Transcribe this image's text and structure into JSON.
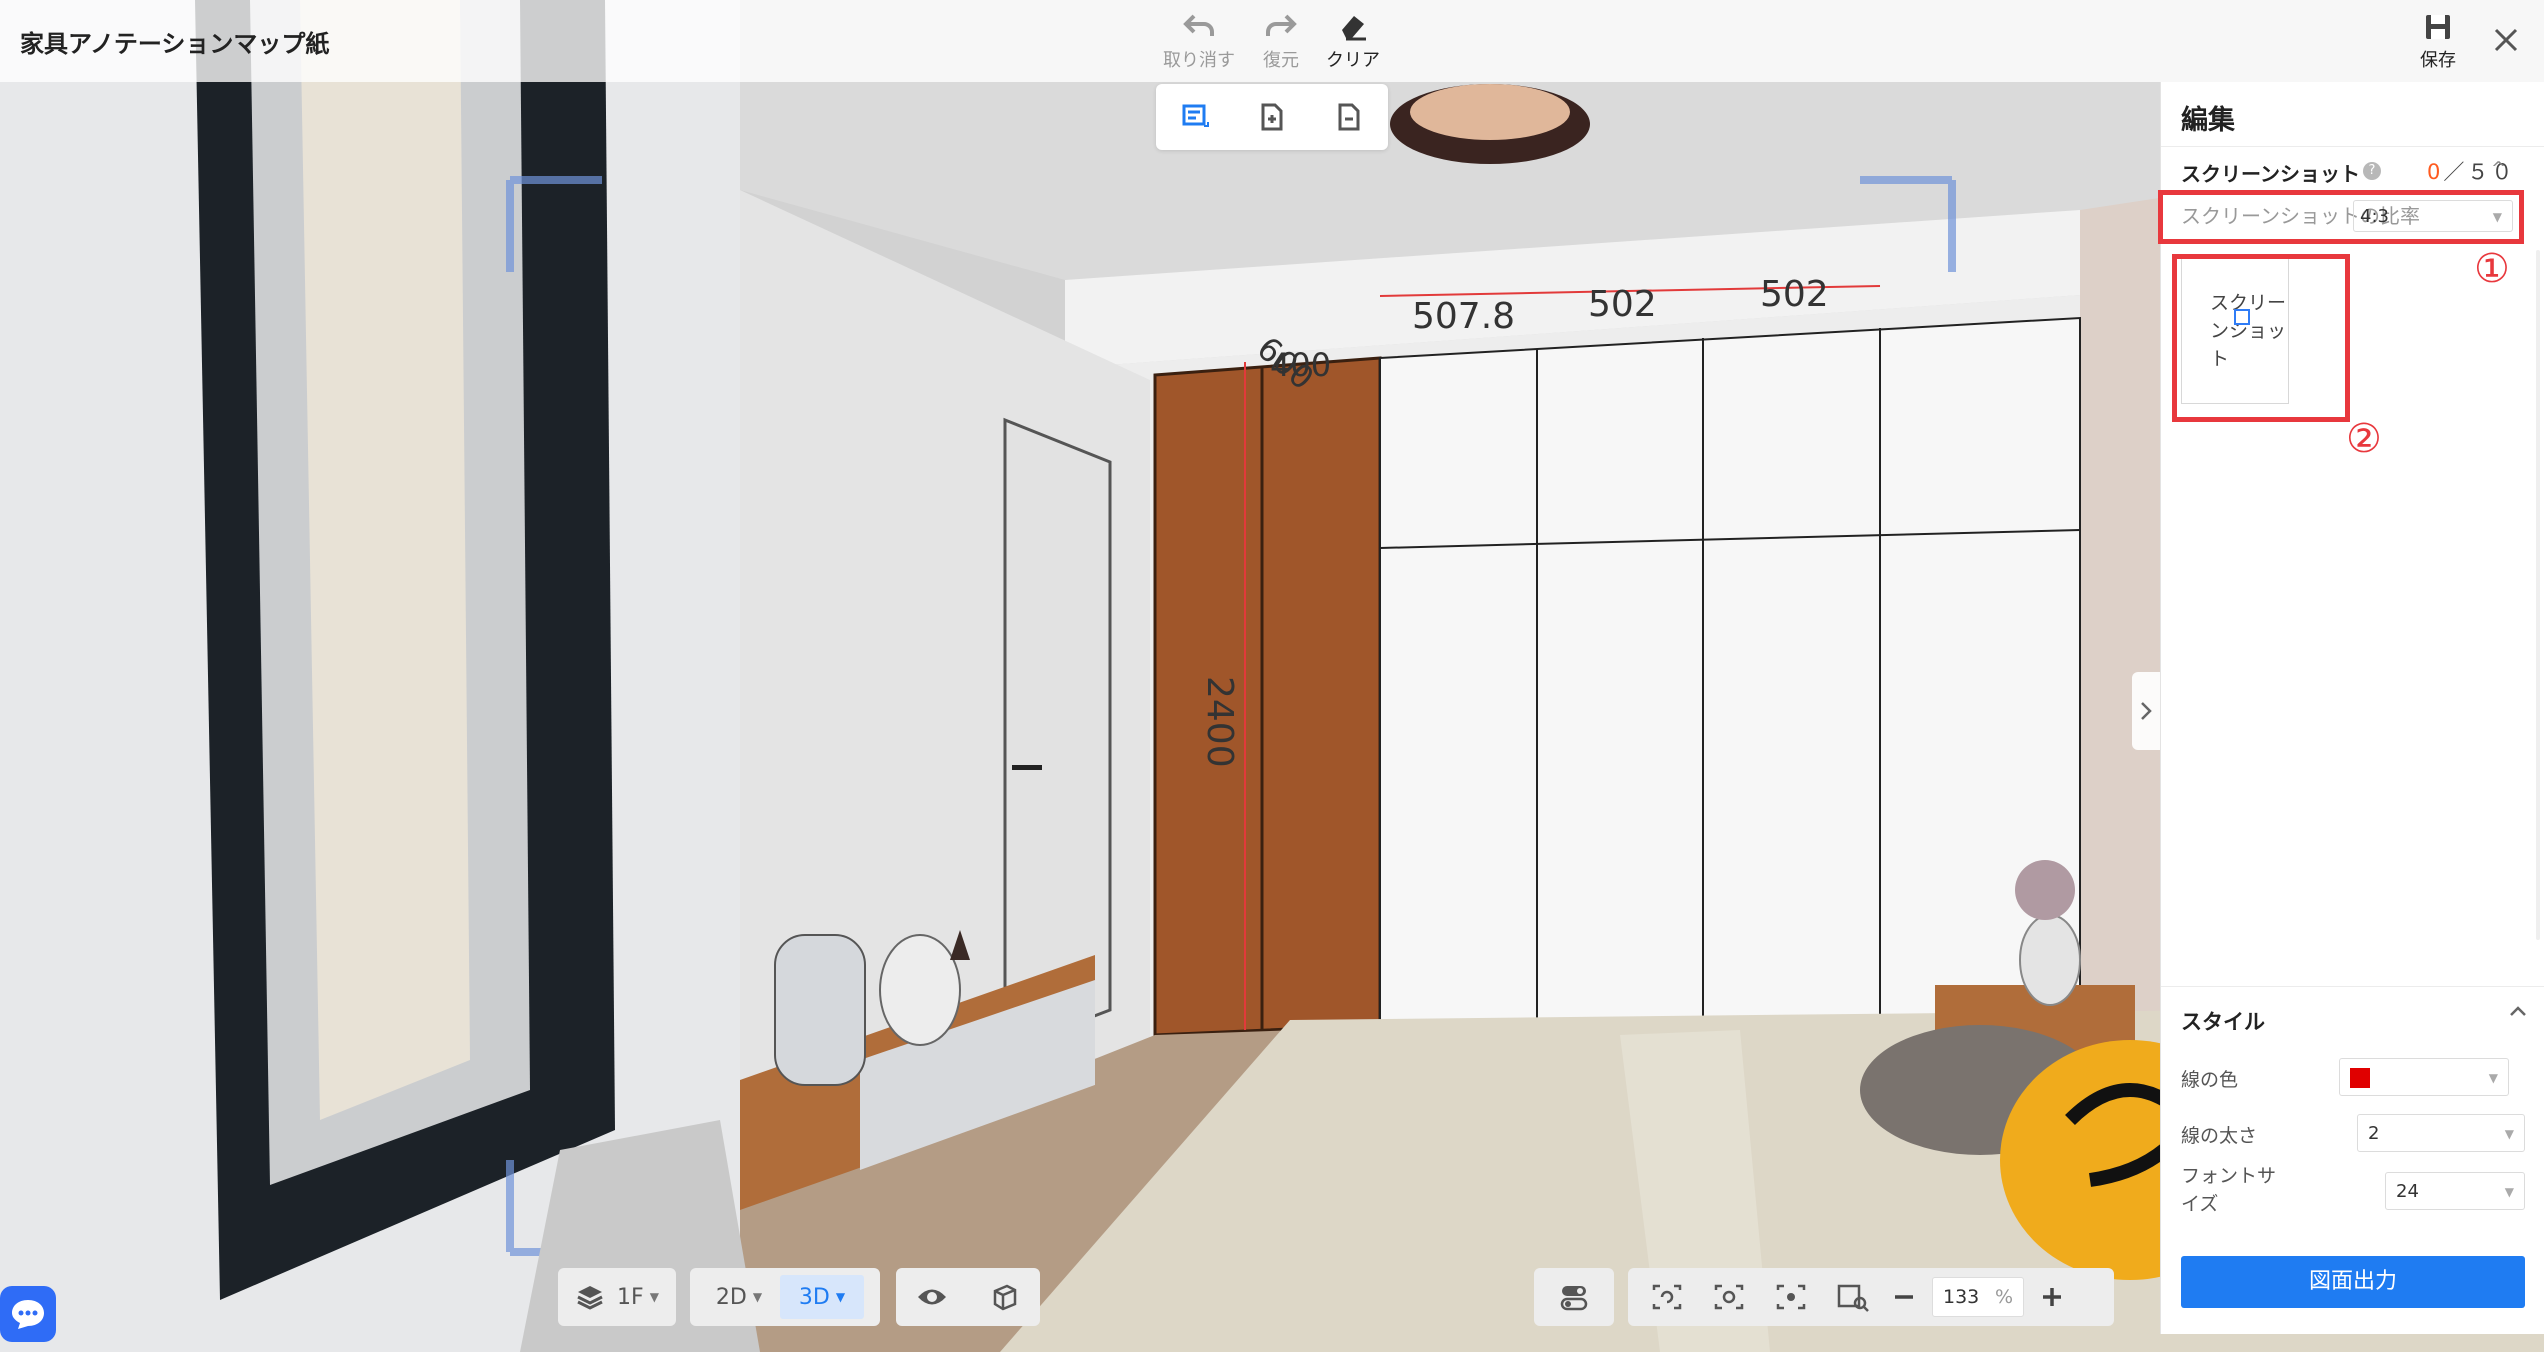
{
  "app": {
    "title": "家具アノテーションマップ紙"
  },
  "toolbar": {
    "undo_label": "取り消す",
    "redo_label": "復元",
    "clear_label": "クリア",
    "save_label": "保存"
  },
  "panel": {
    "title": "編集",
    "screenshot": {
      "header": "スクリーンショット",
      "count_current": "0",
      "count_max": "／５０",
      "ratio_label": "スクリーンショットの比率",
      "ratio_value": "4:3",
      "thumb_text": "スクリーンショット"
    },
    "annotations": {
      "circle1": "①",
      "circle2": "②"
    },
    "style": {
      "header": "スタイル",
      "line_color_label": "線の色",
      "line_color_value": "#e00000",
      "line_width_label": "線の太さ",
      "line_width_value": "2",
      "font_size_label": "フォントサイズ",
      "font_size_value": "24"
    },
    "export_label": "図面出力"
  },
  "dimensions": {
    "d1": "507.8",
    "d2": "502",
    "d3": "502",
    "d4": "600",
    "d5": "400",
    "height": "2400"
  },
  "bottom": {
    "floor_label": "1F",
    "view_2d": "2D",
    "view_3d": "3D",
    "zoom_value": "133",
    "zoom_unit": "%"
  },
  "colors": {
    "accent": "#1f7cf2",
    "annotation_red": "#e8383d",
    "count_orange": "#ff5a1f"
  }
}
